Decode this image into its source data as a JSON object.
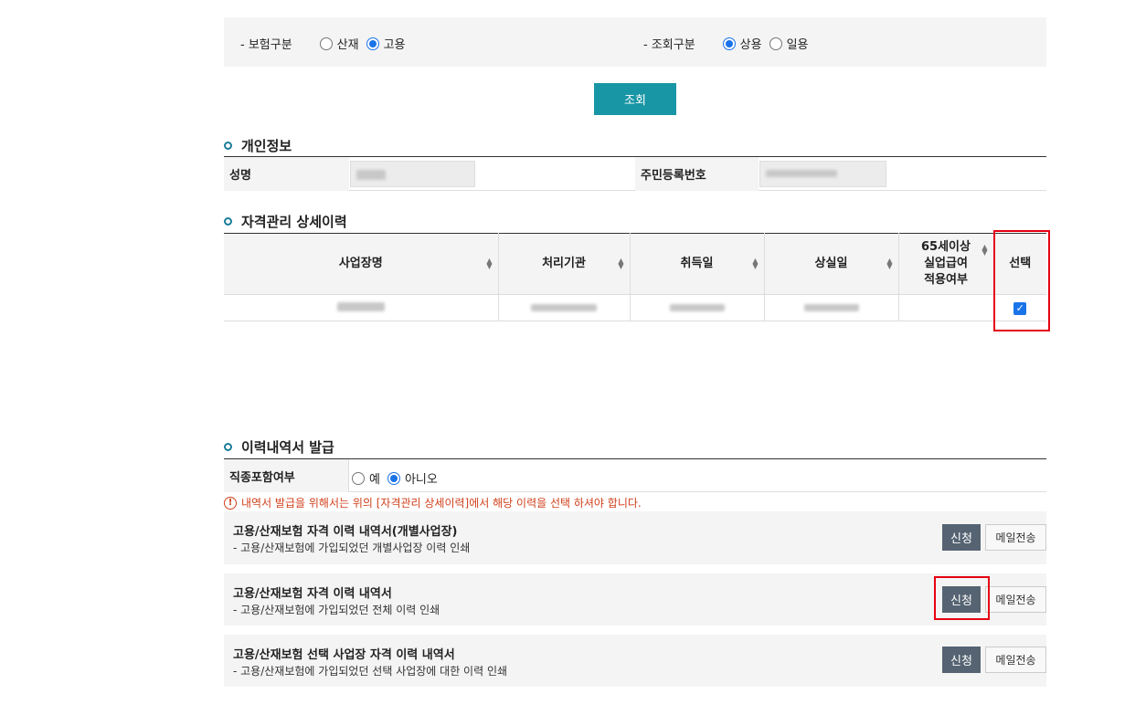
{
  "filter": {
    "insurance_label": "- 보험구분",
    "insurance_options": [
      {
        "label": "산재",
        "selected": false
      },
      {
        "label": "고용",
        "selected": true
      }
    ],
    "query_label": "- 조회구분",
    "query_options": [
      {
        "label": "상용",
        "selected": true
      },
      {
        "label": "일용",
        "selected": false
      }
    ],
    "search_button": "조회"
  },
  "personal": {
    "title": "개인정보",
    "name_label": "성명",
    "rrn_label": "주민등록번호"
  },
  "history": {
    "title": "자격관리 상세이력",
    "columns": [
      "사업장명",
      "처리기관",
      "취득일",
      "상실일",
      "65세이상",
      "실업급여",
      "적용여부",
      "선택"
    ],
    "row_selected": true
  },
  "issue": {
    "title": "이력내역서 발급",
    "type_label": "직종포함여부",
    "type_options": [
      {
        "label": "예",
        "selected": false
      },
      {
        "label": "아니오",
        "selected": true
      }
    ],
    "notice_icon": "!",
    "notice": "내역서 발급을 위해서는 위의 [자격관리 상세이력]에서 해당 이력을 선택 하셔야 합니다.",
    "docs": [
      {
        "title": "고용/산재보험 자격 이력 내역서(개별사업장)",
        "desc": "- 고용/산재보험에 가입되었던 개별사업장 이력 인쇄",
        "apply": "신청",
        "mail": "메일전송"
      },
      {
        "title": "고용/산재보험 자격 이력 내역서",
        "desc": "- 고용/산재보험에 가입되었던 전체 이력 인쇄",
        "apply": "신청",
        "mail": "메일전송"
      },
      {
        "title": "고용/산재보험 선택 사업장 자격 이력 내역서",
        "desc": "- 고용/산재보험에 가입되었던 선택 사업장에 대한 이력 인쇄",
        "apply": "신청",
        "mail": "메일전송"
      }
    ]
  },
  "colors": {
    "primary": "#1996a5",
    "apply_button": "#556372",
    "highlight": "#e60012",
    "notice": "#d0401b"
  }
}
